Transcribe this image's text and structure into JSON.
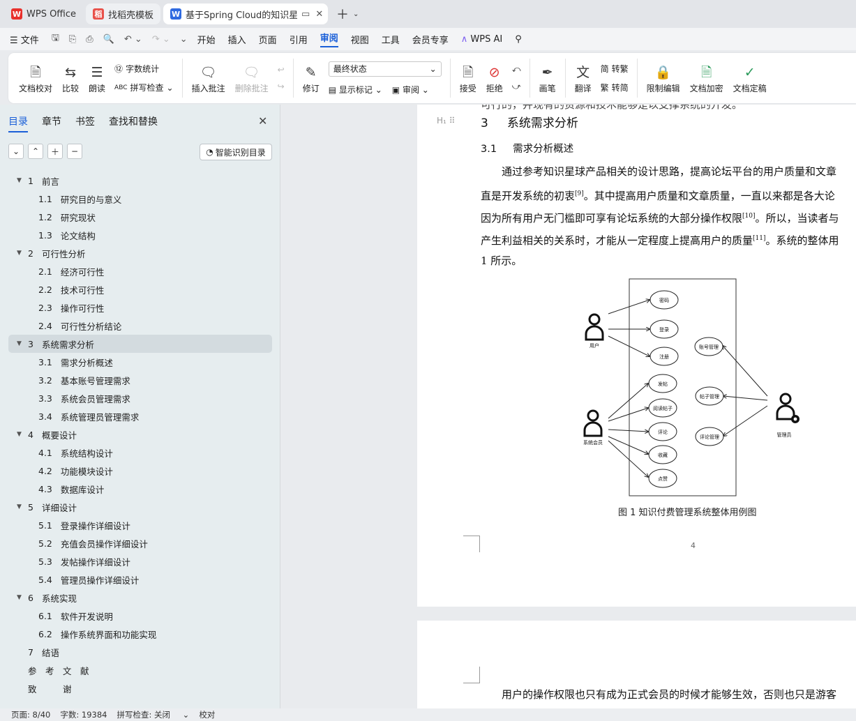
{
  "tabs": [
    {
      "label": "WPS Office",
      "icon": "wps-logo-icon"
    },
    {
      "label": "找稻壳模板",
      "icon": "docer-icon"
    },
    {
      "label": "基于Spring Cloud的知识星球",
      "icon": "word-doc-icon"
    }
  ],
  "menu": {
    "file": "文件",
    "items": [
      "开始",
      "插入",
      "页面",
      "引用",
      "审阅",
      "视图",
      "工具",
      "会员专享"
    ],
    "active": "审阅",
    "ai": "WPS AI"
  },
  "ribbon": {
    "doc_check": "文档校对",
    "compare": "比较",
    "read_aloud": "朗读",
    "word_count": "字数统计",
    "spell_check": "拼写检查",
    "insert_comment": "插入批注",
    "delete_comment": "删除批注",
    "track": "修订",
    "status_value": "最终状态",
    "show_marks": "显示标记",
    "review": "审阅",
    "accept": "接受",
    "reject": "拒绝",
    "pen": "画笔",
    "translate": "翻译",
    "to_trad": "转繁",
    "to_simp": "转简",
    "restrict": "限制编辑",
    "encrypt": "文档加密",
    "finalize": "文档定稿"
  },
  "sidebar": {
    "tabs": [
      "目录",
      "章节",
      "书签",
      "查找和替换"
    ],
    "smart_button": "智能识别目录",
    "toc": [
      {
        "num": "1",
        "text": "前言",
        "level": 1
      },
      {
        "num": "1.1",
        "text": "研究目的与意义",
        "level": 2
      },
      {
        "num": "1.2",
        "text": "研究现状",
        "level": 2
      },
      {
        "num": "1.3",
        "text": "论文结构",
        "level": 2
      },
      {
        "num": "2",
        "text": "可行性分析",
        "level": 1
      },
      {
        "num": "2.1",
        "text": "经济可行性",
        "level": 2
      },
      {
        "num": "2.2",
        "text": "技术可行性",
        "level": 2
      },
      {
        "num": "2.3",
        "text": "操作可行性",
        "level": 2
      },
      {
        "num": "2.4",
        "text": "可行性分析结论",
        "level": 2
      },
      {
        "num": "3",
        "text": "系统需求分析",
        "level": 1,
        "selected": true
      },
      {
        "num": "3.1",
        "text": "需求分析概述",
        "level": 2
      },
      {
        "num": "3.2",
        "text": "基本账号管理需求",
        "level": 2
      },
      {
        "num": "3.3",
        "text": "系统会员管理需求",
        "level": 2
      },
      {
        "num": "3.4",
        "text": "系统管理员管理需求",
        "level": 2
      },
      {
        "num": "4",
        "text": "概要设计",
        "level": 1
      },
      {
        "num": "4.1",
        "text": "系统结构设计",
        "level": 2
      },
      {
        "num": "4.2",
        "text": "功能模块设计",
        "level": 2
      },
      {
        "num": "4.3",
        "text": "数据库设计",
        "level": 2
      },
      {
        "num": "5",
        "text": "详细设计",
        "level": 1
      },
      {
        "num": "5.1",
        "text": "登录操作详细设计",
        "level": 2
      },
      {
        "num": "5.2",
        "text": "充值会员操作详细设计",
        "level": 2
      },
      {
        "num": "5.3",
        "text": "发帖操作详细设计",
        "level": 2
      },
      {
        "num": "5.4",
        "text": "管理员操作详细设计",
        "level": 2
      },
      {
        "num": "6",
        "text": "系统实现",
        "level": 1
      },
      {
        "num": "6.1",
        "text": "软件开发说明",
        "level": 2
      },
      {
        "num": "6.2",
        "text": "操作系统界面和功能实现",
        "level": 2
      },
      {
        "num": "7",
        "text": "结语",
        "level": 0
      },
      {
        "num": "",
        "text": "参　考　文　献",
        "level": 0
      },
      {
        "num": "",
        "text": "致　　　谢",
        "level": 0
      }
    ]
  },
  "document": {
    "top_line": "可行的，并现有的资源和技术能够是以支撑系统的开发。",
    "heading_num": "3",
    "heading": "系统需求分析",
    "sub_num": "3.1",
    "sub": "需求分析概述",
    "lines": [
      {
        "t": "通过参考知识星球产品相关的设计思路，提高论坛平台的用户质量和文章",
        "sup": ""
      },
      {
        "t": "直是开发系统的初衷",
        "sup": "[9]",
        "after": "。其中提高用户质量和文章质量，一直以来都是各大论"
      },
      {
        "t": "因为所有用户无门槛即可享有论坛系统的大部分操作权限",
        "sup": "[10]",
        "after": "。所以，当读者与"
      },
      {
        "t": "产生利益相关的关系时，才能从一定程度上提高用户的质量",
        "sup": "[11]",
        "after": "。系统的整体用"
      },
      {
        "t": "1 所示。",
        "sup": ""
      }
    ],
    "diagram": {
      "actors": [
        "用户",
        "系统会员",
        "管理员"
      ],
      "use_cases": [
        "密码",
        "登录",
        "注册",
        "发帖",
        "阅读帖子",
        "评论",
        "收藏",
        "点赞",
        "账号管理",
        "帖子管理",
        "评论管理"
      ]
    },
    "caption": "图 1  知识付费管理系统整体用例图",
    "page_number": "4",
    "page2_line": "用户的操作权限也只有成为正式会员的时候才能够生效，否则也只是游客"
  },
  "status": {
    "page": "页面: 8/40",
    "words": "字数: 19384",
    "spell": "拼写检查: 关闭",
    "proof": "校对"
  }
}
